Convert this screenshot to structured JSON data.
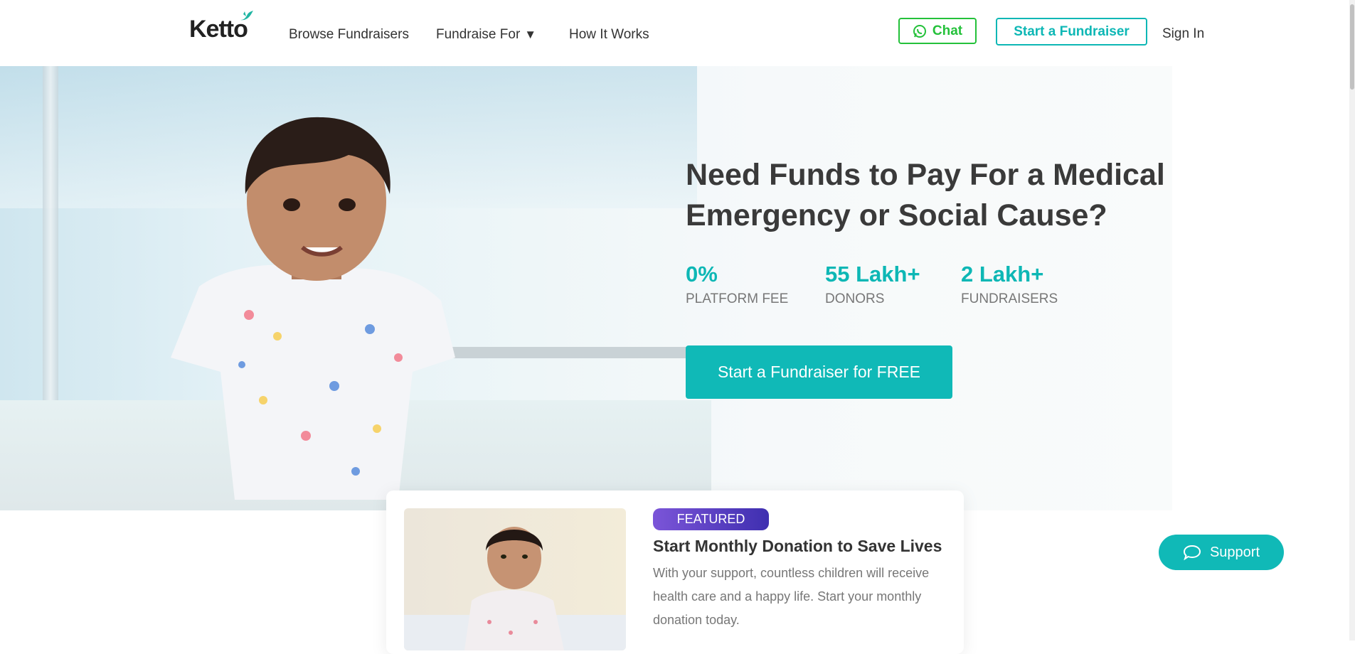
{
  "header": {
    "logo_text": "Ketto",
    "nav": {
      "browse": "Browse Fundraisers",
      "fundraise_for": "Fundraise For",
      "fundraise_for_caret": "▼",
      "how_it_works": "How It Works"
    },
    "chat_label": "Chat",
    "start_label": "Start a Fundraiser",
    "signin_label": "Sign In"
  },
  "hero": {
    "title_line1": "Need Funds to Pay For a Medical",
    "title_line2": "Emergency or Social Cause?",
    "stats": [
      {
        "value": "0%",
        "label": "PLATFORM FEE"
      },
      {
        "value": "55 Lakh+",
        "label": "DONORS"
      },
      {
        "value": "2 Lakh+",
        "label": "FUNDRAISERS"
      }
    ],
    "cta_label": "Start a Fundraiser for FREE"
  },
  "featured": {
    "badge": "FEATURED",
    "title": "Start Monthly Donation to Save Lives",
    "description": "With your support, countless children will receive health care and a happy life. Start your monthly donation today."
  },
  "support_label": "Support",
  "colors": {
    "brand_teal": "#0db7b5",
    "whatsapp_green": "#24c13a",
    "badge_purple": "#5b3fc8"
  },
  "icons": [
    "whatsapp-icon",
    "chat-bubble-icon",
    "caret-down-icon",
    "ketto-bird-icon"
  ]
}
